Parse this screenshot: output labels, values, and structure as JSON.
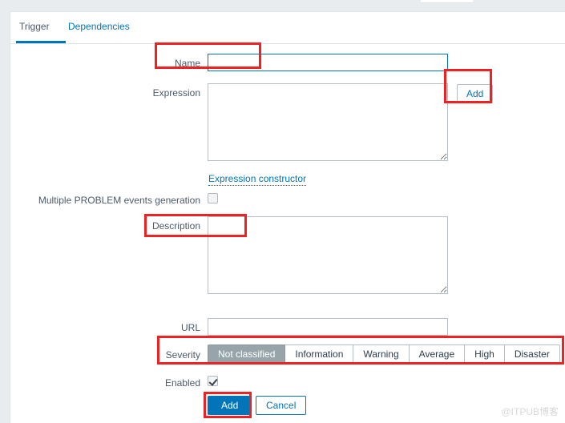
{
  "window": {
    "watermark": "@ITPUB博客"
  },
  "tabs": [
    {
      "label": "Trigger",
      "active": true
    },
    {
      "label": "Dependencies",
      "active": false
    }
  ],
  "form": {
    "name": {
      "label": "Name",
      "value": "",
      "placeholder": "",
      "focused": true
    },
    "expression": {
      "label": "Expression",
      "value": "",
      "placeholder": "",
      "add_button": "Add",
      "constructor_link": "Expression constructor"
    },
    "multiple_problem_events": {
      "label": "Multiple PROBLEM events generation",
      "checked": false
    },
    "description": {
      "label": "Description",
      "value": "",
      "placeholder": ""
    },
    "url": {
      "label": "URL",
      "value": "",
      "placeholder": ""
    },
    "severity": {
      "label": "Severity",
      "selected": "Not classified",
      "options": [
        "Not classified",
        "Information",
        "Warning",
        "Average",
        "High",
        "Disaster"
      ]
    },
    "enabled": {
      "label": "Enabled",
      "checked": true
    }
  },
  "footer": {
    "submit_label": "Add",
    "cancel_label": "Cancel"
  },
  "colors": {
    "accent": "#0275b8",
    "annotation": "#ee2222",
    "severity_selected_bg": "#97a5ab",
    "page_bg": "#e8ecef"
  }
}
